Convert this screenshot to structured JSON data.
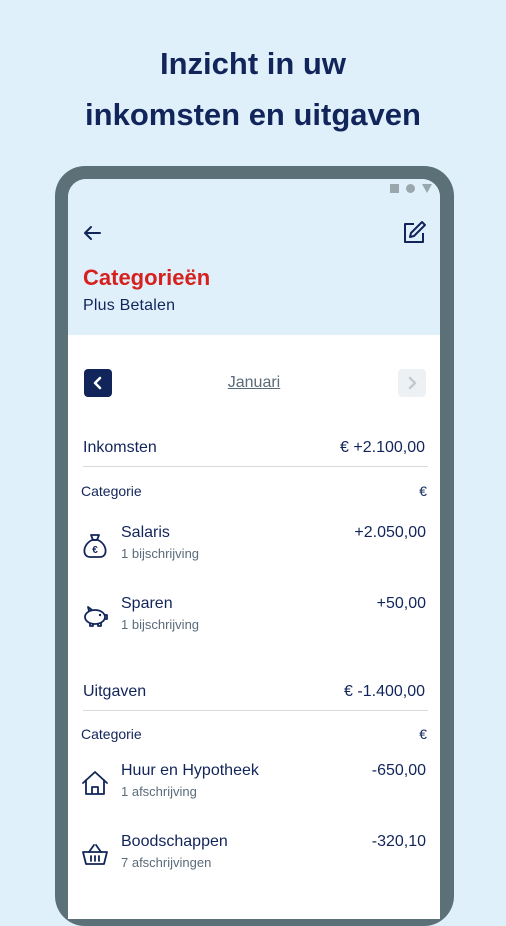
{
  "promo": {
    "line1": "Inzicht in uw",
    "line2": "inkomsten en uitgaven"
  },
  "header": {
    "title": "Categorieën",
    "subtitle": "Plus Betalen"
  },
  "month": {
    "label": "Januari"
  },
  "inkomsten": {
    "label": "Inkomsten",
    "total": "€ +2.100,00",
    "col_category": "Categorie",
    "col_amount": "€",
    "items": [
      {
        "name": "Salaris",
        "sub": "1 bijschrijving",
        "amount": "+2.050,00",
        "icon": "money-bag-icon"
      },
      {
        "name": "Sparen",
        "sub": "1 bijschrijving",
        "amount": "+50,00",
        "icon": "piggy-bank-icon"
      }
    ]
  },
  "uitgaven": {
    "label": "Uitgaven",
    "total": "€ -1.400,00",
    "col_category": "Categorie",
    "col_amount": "€",
    "items": [
      {
        "name": "Huur en Hypotheek",
        "sub": "1 afschrijving",
        "amount": "-650,00",
        "icon": "house-icon"
      },
      {
        "name": "Boodschappen",
        "sub": "7 afschrijvingen",
        "amount": "-320,10",
        "icon": "basket-icon"
      }
    ]
  },
  "colors": {
    "navy": "#12255a",
    "accent_red": "#d6211f",
    "bg_light_blue": "#dff0fb",
    "frame": "#5b7077"
  }
}
